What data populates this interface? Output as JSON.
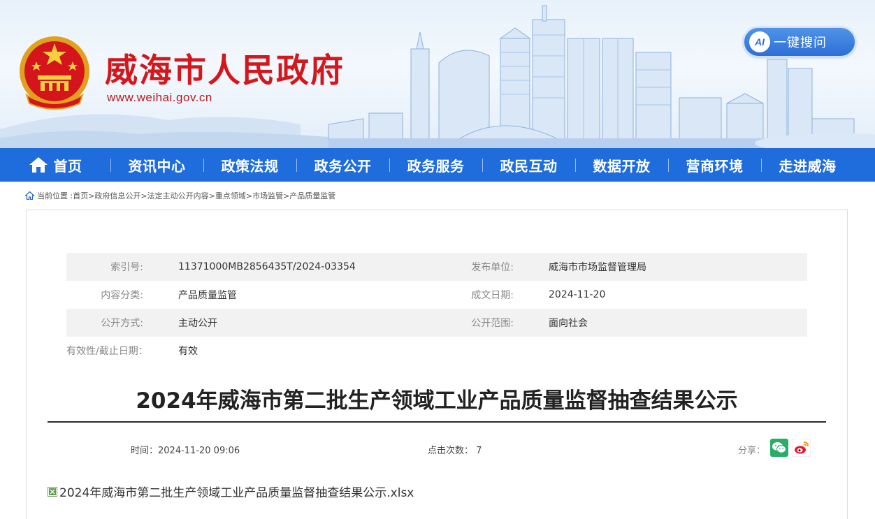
{
  "header": {
    "site_title": "威海市人民政府",
    "site_url": "www.weihai.gov.cn",
    "ai_search_badge": "AI",
    "ai_search_label": "一键搜问",
    "brand_red": "#d3181d",
    "icons": {
      "emblem": "national-emblem-icon",
      "ai": "ai-search-icon"
    }
  },
  "nav": {
    "color": "#1f6cdc",
    "items": [
      {
        "label": "首页",
        "icon": "home-icon"
      },
      {
        "label": "资讯中心"
      },
      {
        "label": "政策法规"
      },
      {
        "label": "政务公开"
      },
      {
        "label": "政务服务"
      },
      {
        "label": "政民互动"
      },
      {
        "label": "数据开放"
      },
      {
        "label": "营商环境"
      },
      {
        "label": "走进威海"
      }
    ]
  },
  "breadcrumb": {
    "prefix": "当前位置 :",
    "items": [
      "首页",
      "政府信息公开",
      "法定主动公开内容",
      "重点领域",
      "市场监管",
      "产品质量监管"
    ],
    "separator": ">"
  },
  "meta": {
    "rows": [
      {
        "label1": "索引号:",
        "value1": "11371000MB2856435T/2024-03354",
        "label2": "发布单位:",
        "value2": "威海市市场监督管理局"
      },
      {
        "label1": "内容分类:",
        "value1": "产品质量监管",
        "label2": "成文日期:",
        "value2": "2024-11-20"
      },
      {
        "label1": "公开方式:",
        "value1": "主动公开",
        "label2": "公开范围:",
        "value2": "面向社会"
      },
      {
        "label1": "有效性/截止日期：",
        "value1": "有效"
      }
    ]
  },
  "article": {
    "title": "2024年威海市第二批生产领域工业产品质量监督抽查结果公示",
    "time": "时间：2024-11-20 09:06",
    "views": "点击次数： 7",
    "share_label": "分享：",
    "share_icons": [
      "wechat-icon",
      "weibo-icon"
    ],
    "attachment_name": "2024年威海市第二批生产领域工业产品质量监督抽查结果公示.xlsx",
    "attachment_icon": "excel-file-icon"
  }
}
